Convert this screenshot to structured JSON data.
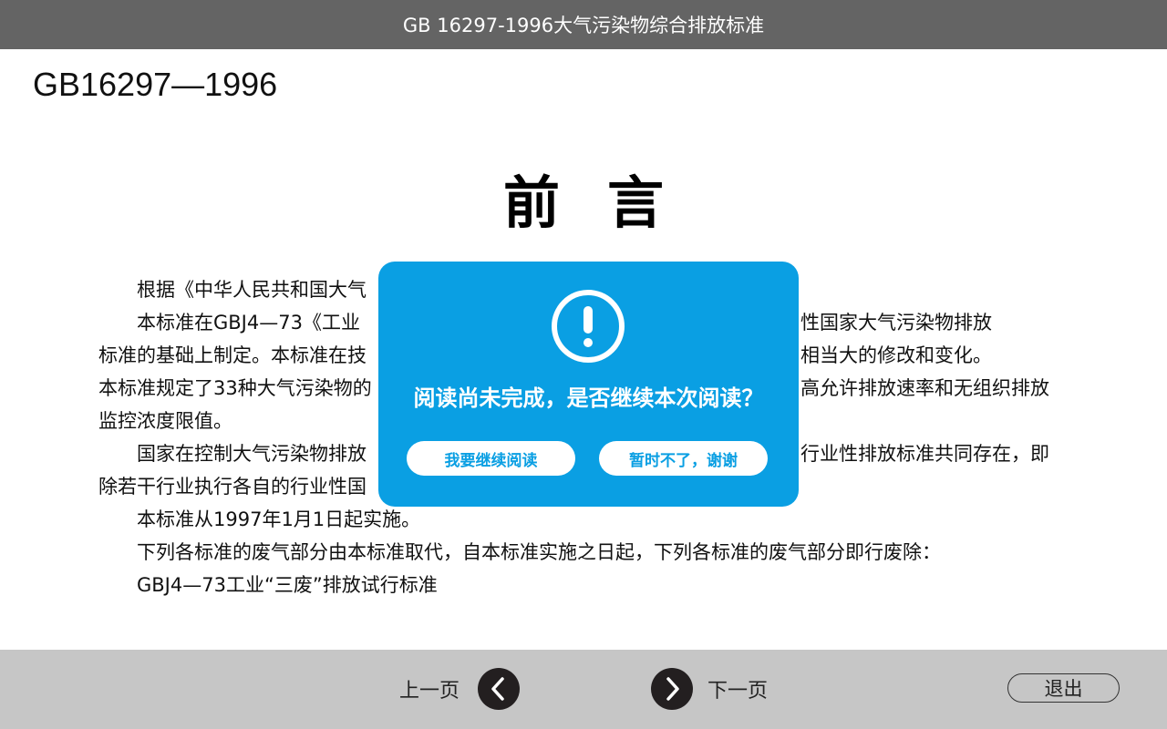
{
  "window": {
    "title": "GB 16297-1996大气污染物综合排放标准"
  },
  "document": {
    "code": "GB16297—1996",
    "heading": "前言",
    "paragraphs": [
      {
        "text": "根据《中华人民共和国大气",
        "indent": true
      },
      {
        "text": "本标准在GBJ4—73《工业",
        "indent": true,
        "tail": "性国家大气污染物排放"
      },
      {
        "text": "标准的基础上制定。本标准在技",
        "indent": false,
        "tail": "相当大的修改和变化。"
      },
      {
        "text": "本标准规定了33种大气污染物的",
        "indent": false,
        "tail": "高允许排放速率和无组织排放"
      },
      {
        "text": "监控浓度限值。",
        "indent": false
      },
      {
        "text": "国家在控制大气污染物排放",
        "indent": true,
        "tail": "行业性排放标准共同存在，即"
      },
      {
        "text": "除若干行业执行各自的行业性国",
        "indent": false
      },
      {
        "text": "本标准从1997年1月1日起实施。",
        "indent": true
      },
      {
        "text": "下列各标准的废气部分由本标准取代，自本标准实施之日起，下列各标准的废气部分即行废除：",
        "indent": true
      },
      {
        "text": "GBJ4—73工业“三废”排放试行标准",
        "indent": true
      }
    ]
  },
  "dialog": {
    "icon": "exclamation-circle-icon",
    "message": "阅读尚未完成，是否继续本次阅读？",
    "continue_label": "我要继续阅读",
    "decline_label": "暂时不了，谢谢",
    "color": "#0a9fe3"
  },
  "footer": {
    "prev_label": "上一页",
    "next_label": "下一页",
    "exit_label": "退出",
    "prev_icon": "chevron-left-icon",
    "next_icon": "chevron-right-icon"
  }
}
